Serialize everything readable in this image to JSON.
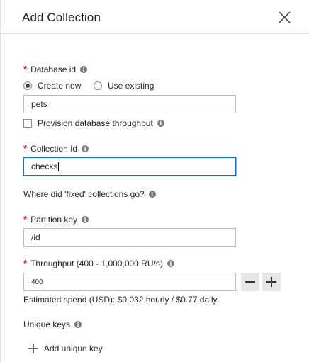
{
  "header": {
    "title": "Add Collection"
  },
  "database": {
    "label": "Database id",
    "radio_create": "Create new",
    "radio_existing": "Use existing",
    "value": "pets",
    "provision_label": "Provision database throughput"
  },
  "collection": {
    "label": "Collection Id",
    "value": "checks"
  },
  "fixed_link": "Where did 'fixed' collections go?",
  "partition": {
    "label": "Partition key",
    "value": "/id"
  },
  "throughput": {
    "label": "Throughput (400 - 1,000,000 RU/s)",
    "value": "400",
    "estimate": "Estimated spend (USD): $0.032 hourly / $0.77 daily."
  },
  "unique_keys": {
    "label": "Unique keys",
    "add_label": "Add unique key"
  },
  "required_marker": "*",
  "info_glyph": "i"
}
